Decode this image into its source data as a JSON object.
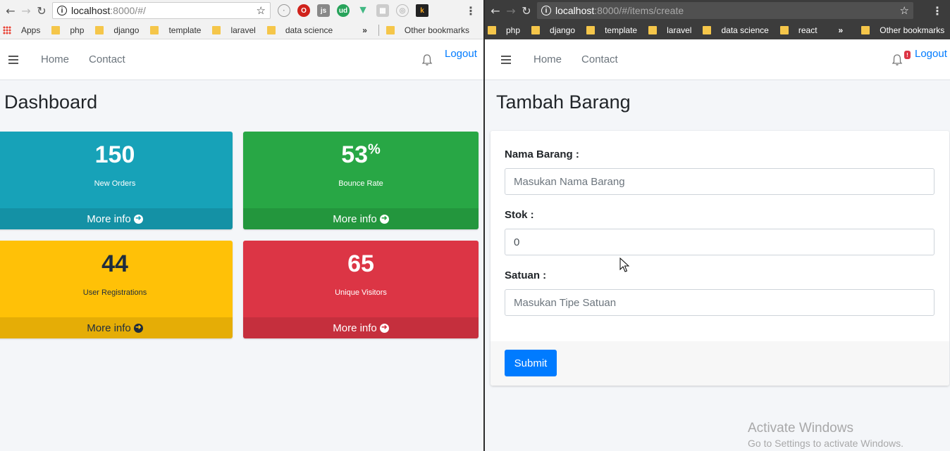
{
  "left_browser": {
    "url_host": "localhost",
    "url_rest": ":8000/#/",
    "bookmarks": [
      "Apps",
      "php",
      "django",
      "template",
      "laravel",
      "data science"
    ],
    "overflow": "»",
    "other_bookmarks": "Other bookmarks",
    "extensions": [
      "js",
      "ud",
      "k"
    ]
  },
  "right_browser": {
    "url_host": "localhost",
    "url_rest": ":8000/#/items/create",
    "bookmarks": [
      "php",
      "django",
      "template",
      "laravel",
      "data science",
      "react"
    ],
    "overflow": "»",
    "other_bookmarks": "Other bookmarks"
  },
  "navbar": {
    "links": [
      "Home",
      "Contact"
    ],
    "logout": "Logout",
    "notification_badge": "!"
  },
  "dashboard": {
    "title": "Dashboard",
    "more_info": "More info",
    "boxes": [
      {
        "value": "150",
        "suffix": "",
        "label": "New Orders",
        "color": "#17a2b8"
      },
      {
        "value": "53",
        "suffix": "%",
        "label": "Bounce Rate",
        "color": "#28a745"
      },
      {
        "value": "44",
        "suffix": "",
        "label": "User Registrations",
        "color": "#ffc107"
      },
      {
        "value": "65",
        "suffix": "",
        "label": "Unique Visitors",
        "color": "#dc3545"
      }
    ]
  },
  "form": {
    "title": "Tambah Barang",
    "fields": [
      {
        "label": "Nama Barang :",
        "value": "",
        "placeholder": "Masukan Nama Barang"
      },
      {
        "label": "Stok :",
        "value": "0",
        "placeholder": ""
      },
      {
        "label": "Satuan :",
        "value": "",
        "placeholder": "Masukan Tipe Satuan"
      }
    ],
    "submit": "Submit"
  },
  "watermark": {
    "line1": "Activate Windows",
    "line2": "Go to Settings to activate Windows."
  }
}
